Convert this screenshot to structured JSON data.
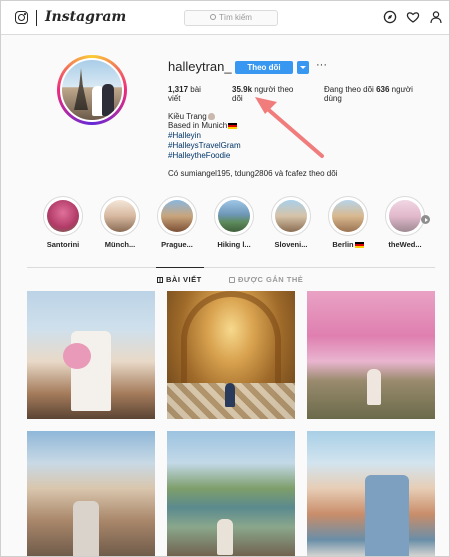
{
  "nav": {
    "logo_text": "Instagram",
    "search_placeholder": "Tìm kiếm",
    "icons": [
      "instagram-glyph-icon",
      "compass-icon",
      "heart-icon",
      "person-icon"
    ]
  },
  "profile": {
    "username": "halleytran_",
    "follow_label": "Theo dõi",
    "more_label": "···",
    "stats": {
      "posts_count": "1,317",
      "posts_label": "bài viết",
      "followers_count": "35.9k",
      "followers_label": "người theo dõi",
      "following_prefix": "Đang theo dõi",
      "following_count": "636",
      "following_label": "người dùng"
    },
    "bio": {
      "name": "Kiều Trang",
      "location": "Based in Munich",
      "tags": [
        "#Halleyin",
        "#HalleysTravelGram",
        "#HalleytheFoodie"
      ]
    },
    "mutual": "Có sumiangel195, tdung2806 và fcafez theo dõi"
  },
  "highlights": [
    {
      "label": "Santorini"
    },
    {
      "label": "Münch..."
    },
    {
      "label": "Prague..."
    },
    {
      "label": "Hiking l..."
    },
    {
      "label": "Sloveni..."
    },
    {
      "label": "Berlin"
    },
    {
      "label": "theWed..."
    }
  ],
  "tabs": {
    "posts": "BÀI VIẾT",
    "tagged": "ĐƯỢC GẮN THẺ"
  },
  "posts": [
    {
      "name": "post-girl-flowers-balcony"
    },
    {
      "name": "post-antiquarium-hall"
    },
    {
      "name": "post-cherry-blossom-path"
    },
    {
      "name": "post-old-town-fountain"
    },
    {
      "name": "post-lake-bled-view"
    },
    {
      "name": "post-coastal-town"
    }
  ],
  "colors": {
    "accent": "#3897f0",
    "hashtag": "#003569",
    "annotation_arrow": "#f07c7c"
  }
}
